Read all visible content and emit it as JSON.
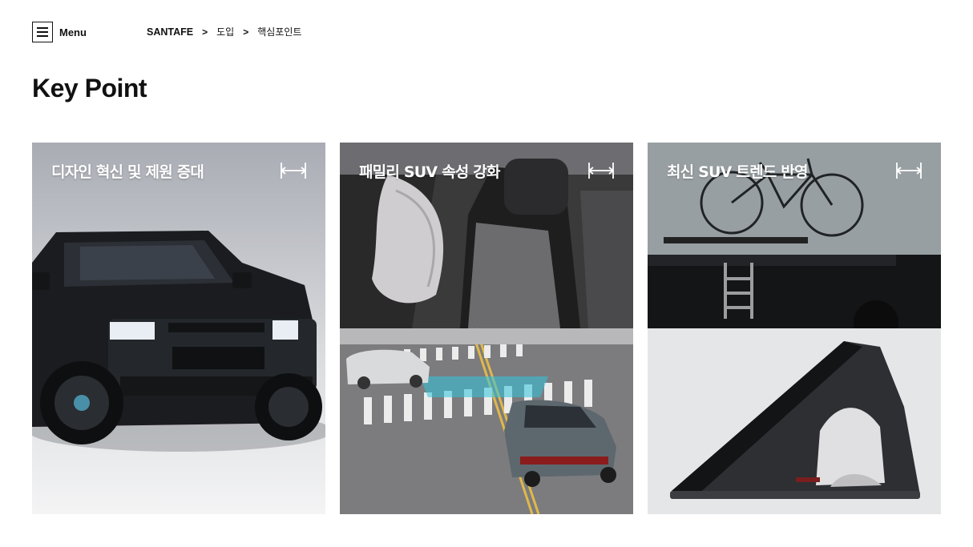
{
  "header": {
    "menu_label": "Menu",
    "breadcrumb": [
      "SANTAFE",
      "도입",
      "핵심포인트"
    ],
    "separator": ">"
  },
  "page": {
    "title": "Key Point"
  },
  "cards": [
    {
      "title": "디자인 혁신 및 제원 증대",
      "icon": "expand-icon"
    },
    {
      "title": "패밀리 SUV 속성 강화",
      "icon": "expand-icon"
    },
    {
      "title": "최신 SUV 트렌드 반영",
      "icon": "expand-icon"
    }
  ],
  "colors": {
    "text": "#111111",
    "background": "#ffffff",
    "card_title": "#ffffff"
  }
}
